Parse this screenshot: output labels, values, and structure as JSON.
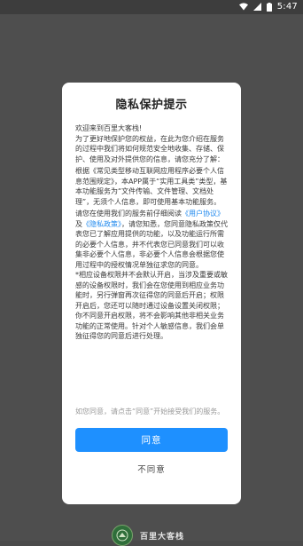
{
  "status_bar": {
    "time": "5:47",
    "icons": [
      "wifi-icon",
      "signal-icon",
      "battery-icon"
    ]
  },
  "dialog": {
    "title": "隐私保护提示",
    "paragraphs": {
      "p1": "欢迎来到百里大客栈!",
      "p2": "为了更好地保护您的权益，在此为您介绍在服务的过程中我们将如何规范安全地收集、存储、保护、使用及对外提供您的信息，请您充分了解：",
      "p3": "根据《常见类型移动互联网应用程序必要个人信息范围规定》，本APP属于“实用工具类”类型，基本功能服务为“文件传输、文件管理、文档处理”，无须个人信息，即可使用基本功能服务。",
      "p4_prefix": "请您在使用我们的服务前仔细阅读",
      "p4_link1": "《用户协议》",
      "p4_and": "及",
      "p4_link2": "《隐私政策》",
      "p4_suffix": "，请您知悉，您同意隐私政策仅代表您已了解应用提供的功能，以及功能运行所需的必要个人信息，并不代表您已同意我们可以收集非必要个人信息，非必要个人信息会根据您使用过程中的授权情况单独征求您的同意。",
      "p5": "*相应设备权限并不会默认开启，当涉及重要或敏感的设备权限时，我们会在您使用到相应业务功能时，另行弹窗再次征得您的同意后开启；权限开启后，您还可以随时通过设备设置关闭权限；你不同意开启权限，将不会影响其他非相关业务功能的正常使用。针对个人敏感信息，我们会单独征得您的同意后进行处理。"
    },
    "note": "如您同意，请点击“同意”开始接受我们的服务。",
    "agree_label": "同意",
    "disagree_label": "不同意",
    "colors": {
      "accent": "#1e90ff",
      "link": "#1e88ee"
    }
  },
  "brand": {
    "name": "百里大客栈"
  }
}
